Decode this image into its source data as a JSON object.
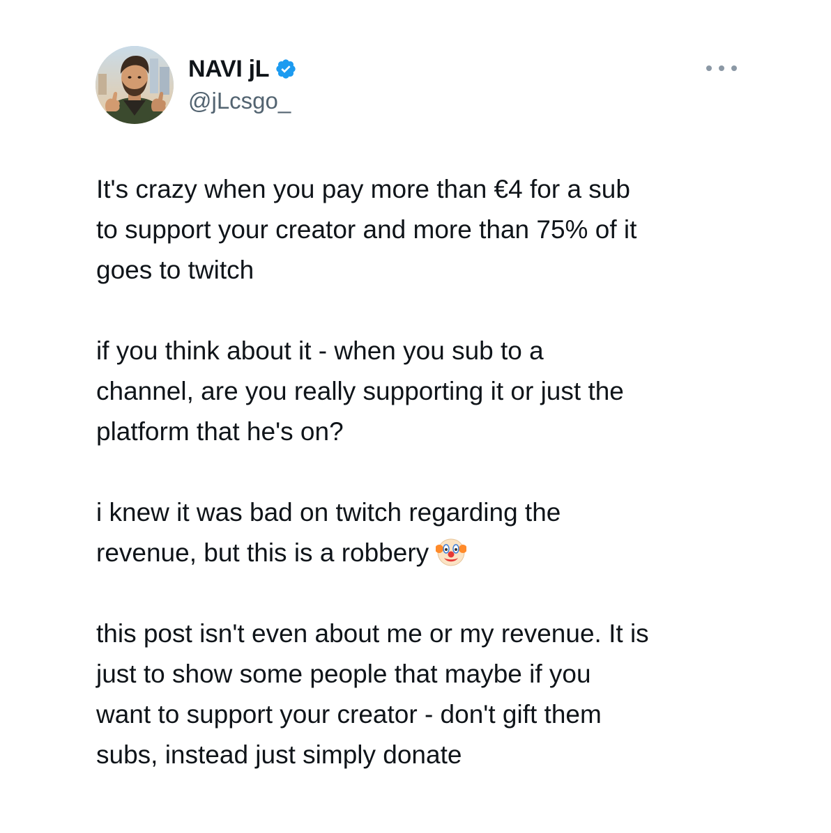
{
  "author": {
    "display_name": "NAVI jL",
    "handle": "@jLcsgo_",
    "verified": true,
    "verified_color": "#1d9bf0",
    "avatar_icon": "avatar-image"
  },
  "more_icon": "more-options-icon",
  "paragraphs": [
    {
      "lines": [
        "It's crazy when you pay more than €4 for a sub",
        "to support your creator and more than 75% of it",
        "goes to twitch"
      ]
    },
    {
      "lines": [
        "if you think about it - when you sub to a",
        "channel, are you really supporting it or just the",
        "platform that he's on?"
      ]
    },
    {
      "lines": [
        "i knew it was bad on twitch regarding the",
        "revenue, but this is a robbery"
      ],
      "trailing_emoji": "clown-face-emoji"
    },
    {
      "lines": [
        "this post isn't even about me or my revenue. It is",
        "just to show some people that maybe if you",
        "want to support your creator - don't gift them",
        "subs, instead just simply donate"
      ]
    }
  ],
  "colors": {
    "text": "#0f1419",
    "secondary": "#536471",
    "background": "#ffffff"
  }
}
